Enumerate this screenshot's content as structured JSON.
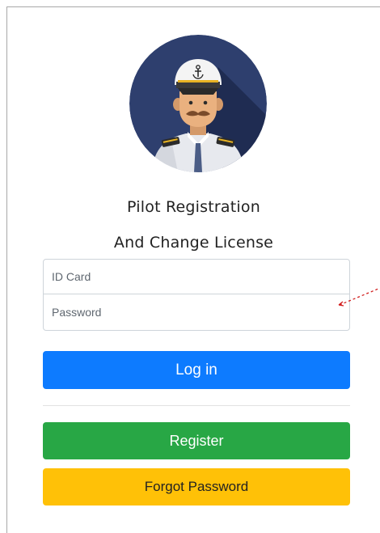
{
  "login_form": {
    "title_line1": "Pilot Registration",
    "title_line2": "And Change License",
    "id_card_placeholder": "ID Card",
    "password_placeholder": "Password",
    "login_label": "Log in",
    "register_label": "Register",
    "forgot_password_label": "Forgot Password"
  },
  "icons": {
    "avatar": "pilot-avatar-icon"
  },
  "colors": {
    "login_button": "#0d7bff",
    "register_button": "#28a745",
    "forgot_button": "#ffc107",
    "avatar_background": "#2e3f6e"
  }
}
